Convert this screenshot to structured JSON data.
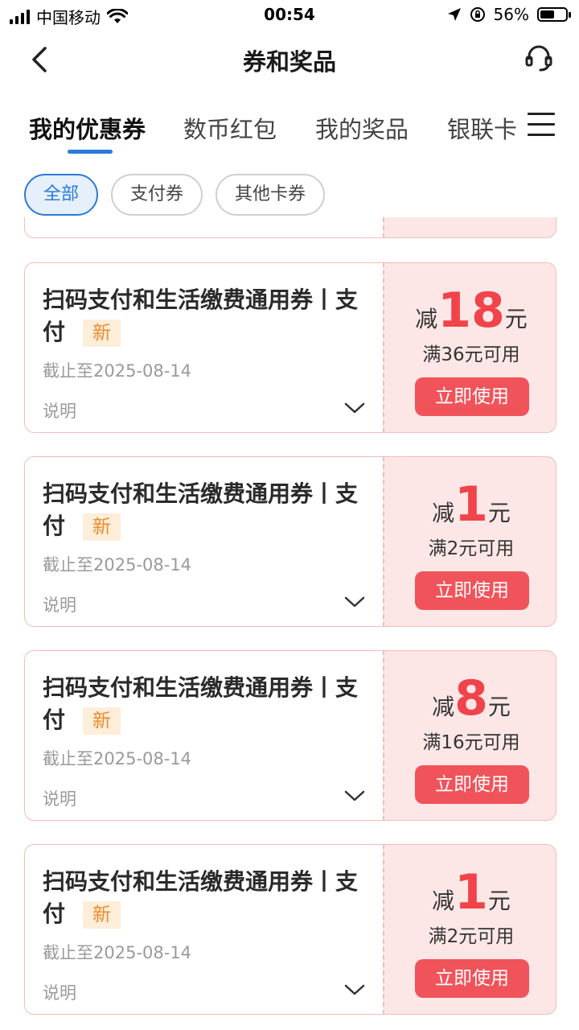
{
  "status": {
    "carrier": "中国移动",
    "time": "00:54",
    "battery": "56%",
    "battery_level": 0.56
  },
  "nav": {
    "title": "券和奖品"
  },
  "tabs": [
    "我的优惠券",
    "数币红包",
    "我的奖品",
    "银联卡"
  ],
  "chips": [
    "全部",
    "支付券",
    "其他卡券"
  ],
  "coupons": [
    {
      "title": "扫码支付和生活缴费通用券丨支付",
      "badge": "新",
      "expire": "截止至2025-08-14",
      "note": "说明",
      "prefix": "减",
      "amount": "18",
      "suffix": "元",
      "condition": "满36元可用",
      "button": "立即使用"
    },
    {
      "title": "扫码支付和生活缴费通用券丨支付",
      "badge": "新",
      "expire": "截止至2025-08-14",
      "note": "说明",
      "prefix": "减",
      "amount": "1",
      "suffix": "元",
      "condition": "满2元可用",
      "button": "立即使用"
    },
    {
      "title": "扫码支付和生活缴费通用券丨支付",
      "badge": "新",
      "expire": "截止至2025-08-14",
      "note": "说明",
      "prefix": "减",
      "amount": "8",
      "suffix": "元",
      "condition": "满16元可用",
      "button": "立即使用"
    },
    {
      "title": "扫码支付和生活缴费通用券丨支付",
      "badge": "新",
      "expire": "截止至2025-08-14",
      "note": "说明",
      "prefix": "减",
      "amount": "1",
      "suffix": "元",
      "condition": "满2元可用",
      "button": "立即使用"
    }
  ],
  "colors": {
    "accent": "#2a7ad9",
    "coupon_red": "#f0434a",
    "button_red": "#f0535a",
    "coupon_bg": "#fde7e6",
    "badge_orange": "#f08a2c"
  },
  "icons": [
    "back-arrow-icon",
    "customer-service-icon",
    "menu-icon",
    "chevron-down-icon"
  ]
}
